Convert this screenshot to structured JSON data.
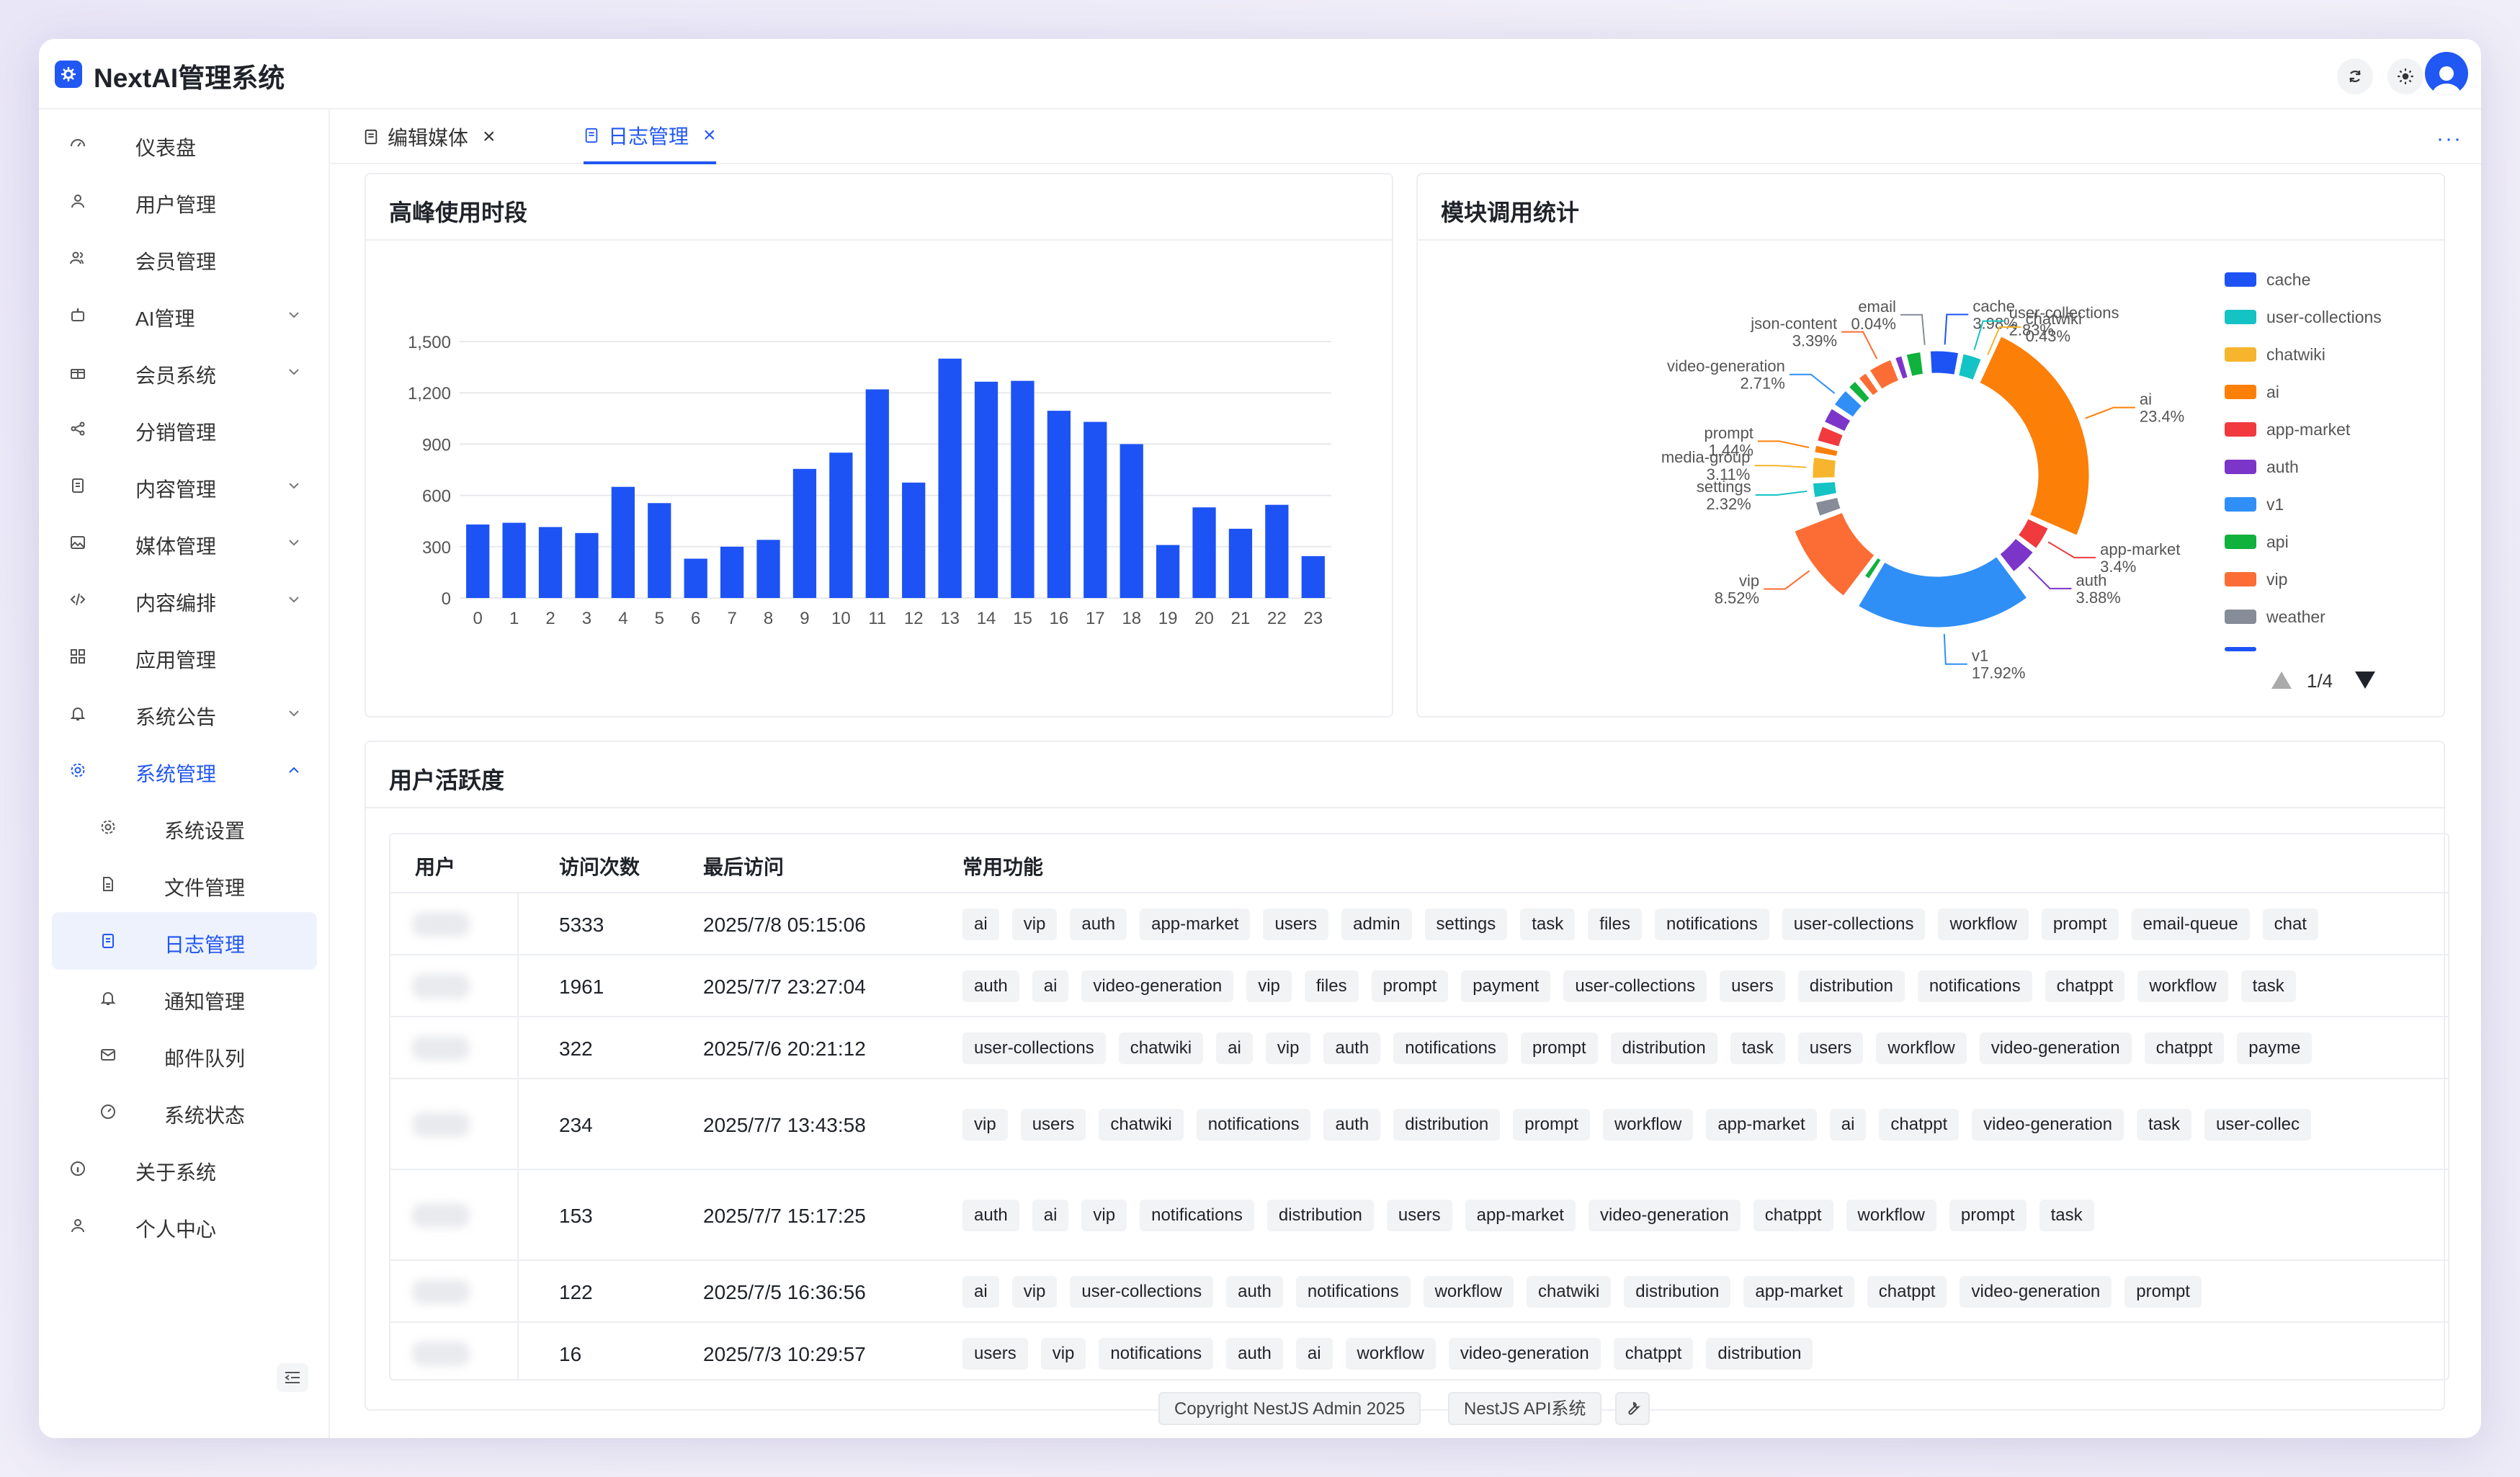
{
  "app": {
    "title": "NextAI管理系统"
  },
  "sidebar": {
    "items": [
      {
        "label": "仪表盘",
        "icon": "dashboard-icon",
        "expandable": false
      },
      {
        "label": "用户管理",
        "icon": "user-icon",
        "expandable": false
      },
      {
        "label": "会员管理",
        "icon": "members-icon",
        "expandable": false
      },
      {
        "label": "AI管理",
        "icon": "robot-icon",
        "expandable": true
      },
      {
        "label": "会员系统",
        "icon": "gift-icon",
        "expandable": true
      },
      {
        "label": "分销管理",
        "icon": "share-icon",
        "expandable": false
      },
      {
        "label": "内容管理",
        "icon": "document-icon",
        "expandable": true
      },
      {
        "label": "媒体管理",
        "icon": "image-icon",
        "expandable": true
      },
      {
        "label": "内容编排",
        "icon": "code-icon",
        "expandable": true
      },
      {
        "label": "应用管理",
        "icon": "apps-icon",
        "expandable": false
      },
      {
        "label": "系统公告",
        "icon": "bell-icon",
        "expandable": true
      },
      {
        "label": "系统管理",
        "icon": "gear-icon",
        "expandable": true,
        "expanded": true
      }
    ],
    "sub_items": [
      {
        "label": "系统设置",
        "icon": "gear-icon"
      },
      {
        "label": "文件管理",
        "icon": "file-icon"
      },
      {
        "label": "日志管理",
        "icon": "log-icon",
        "active": true
      },
      {
        "label": "通知管理",
        "icon": "bell-icon"
      },
      {
        "label": "邮件队列",
        "icon": "mail-icon"
      },
      {
        "label": "系统状态",
        "icon": "gauge-icon"
      }
    ],
    "bottom_items": [
      {
        "label": "关于系统",
        "icon": "info-icon"
      },
      {
        "label": "个人中心",
        "icon": "user-icon"
      }
    ]
  },
  "tabs": [
    {
      "label": "编辑媒体",
      "active": false
    },
    {
      "label": "日志管理",
      "active": true
    }
  ],
  "cards": {
    "peak": {
      "title": "高峰使用时段"
    },
    "modules": {
      "title": "模块调用统计",
      "pager": "1/4"
    },
    "activity": {
      "title": "用户活跃度"
    }
  },
  "chart_data": [
    {
      "type": "bar",
      "categories": [
        "0",
        "1",
        "2",
        "3",
        "4",
        "5",
        "6",
        "7",
        "8",
        "9",
        "10",
        "11",
        "12",
        "13",
        "14",
        "15",
        "16",
        "17",
        "18",
        "19",
        "20",
        "21",
        "22",
        "23"
      ],
      "values": [
        430,
        440,
        415,
        380,
        650,
        555,
        230,
        300,
        340,
        755,
        850,
        1220,
        675,
        1400,
        1265,
        1270,
        1095,
        1030,
        900,
        310,
        530,
        405,
        545,
        245
      ],
      "ylim": [
        0,
        1500
      ],
      "yticks": [
        0,
        300,
        600,
        900,
        1200,
        1500
      ],
      "ytick_labels": [
        "0",
        "300",
        "600",
        "900",
        "1,200",
        "1,500"
      ],
      "grid": true,
      "color": "#1d53f5"
    },
    {
      "type": "pie",
      "donut": true,
      "slices": [
        {
          "name": "cache",
          "label": "3.98%",
          "value": 3.98,
          "color": "#1d53f5"
        },
        {
          "name": "user-collections",
          "label": "2.83%",
          "value": 2.83,
          "color": "#14c3c4"
        },
        {
          "name": "chatwiki",
          "label": "0.43%",
          "value": 0.43,
          "color": "#f6b52c"
        },
        {
          "name": "ai",
          "label": "23.4%",
          "value": 23.4,
          "color": "#fc7f08"
        },
        {
          "name": "app-market",
          "label": "3.4%",
          "value": 3.4,
          "color": "#f03a3d"
        },
        {
          "name": "auth",
          "label": "3.88%",
          "value": 3.88,
          "color": "#7c35c9"
        },
        {
          "name": "v1",
          "label": "17.92%",
          "value": 17.92,
          "color": "#2f8ff6"
        },
        {
          "name": "api",
          "label": "",
          "value": 1.2,
          "color": "#10b13c"
        },
        {
          "name": "vip",
          "label": "8.52%",
          "value": 8.52,
          "color": "#fb6d34"
        },
        {
          "name": "weather",
          "label": "",
          "value": 2.3,
          "color": "#868c98"
        },
        {
          "name": "settings",
          "label": "2.32%",
          "value": 2.32,
          "color": "#14c3c4"
        },
        {
          "name": "media-group",
          "label": "3.11%",
          "value": 3.11,
          "color": "#f6b52c"
        },
        {
          "name": "prompt",
          "label": "1.44%",
          "value": 1.44,
          "color": "#fc7f08"
        },
        {
          "name": "",
          "label": "",
          "value": 2.4,
          "color": "#f03a3d"
        },
        {
          "name": "",
          "label": "",
          "value": 2.4,
          "color": "#7c35c9"
        },
        {
          "name": "video-generation",
          "label": "2.71%",
          "value": 2.71,
          "color": "#2f8ff6"
        },
        {
          "name": "",
          "label": "",
          "value": 1.6,
          "color": "#10b13c"
        },
        {
          "name": "",
          "label": "",
          "value": 1.6,
          "color": "#fb6d34"
        },
        {
          "name": "json-content",
          "label": "3.39%",
          "value": 3.39,
          "color": "#fb6d34"
        },
        {
          "name": "",
          "label": "",
          "value": 1.4,
          "color": "#7c35c9"
        },
        {
          "name": "",
          "label": "",
          "value": 2.3,
          "color": "#10b13c"
        },
        {
          "name": "email",
          "label": "0.04%",
          "value": 0.6,
          "color": "#868c98"
        }
      ],
      "legend": {
        "placement": "right",
        "items": [
          {
            "name": "cache",
            "color": "#1d53f5"
          },
          {
            "name": "user-collections",
            "color": "#14c3c4"
          },
          {
            "name": "chatwiki",
            "color": "#f6b52c"
          },
          {
            "name": "ai",
            "color": "#fc7f08"
          },
          {
            "name": "app-market",
            "color": "#f03a3d"
          },
          {
            "name": "auth",
            "color": "#7c35c9"
          },
          {
            "name": "v1",
            "color": "#2f8ff6"
          },
          {
            "name": "api",
            "color": "#10b13c"
          },
          {
            "name": "vip",
            "color": "#fb6d34"
          },
          {
            "name": "weather",
            "color": "#868c98"
          }
        ]
      }
    }
  ],
  "table": {
    "columns": [
      "用户",
      "访问次数",
      "最后访问",
      "常用功能"
    ],
    "rows": [
      {
        "count": "5333",
        "last": "2025/7/8 05:15:06",
        "tags": [
          "ai",
          "vip",
          "auth",
          "app-market",
          "users",
          "admin",
          "settings",
          "task",
          "files",
          "notifications",
          "user-collections",
          "workflow",
          "prompt",
          "email-queue",
          "chat"
        ]
      },
      {
        "count": "1961",
        "last": "2025/7/7 23:27:04",
        "tags": [
          "auth",
          "ai",
          "video-generation",
          "vip",
          "files",
          "prompt",
          "payment",
          "user-collections",
          "users",
          "distribution",
          "notifications",
          "chatppt",
          "workflow",
          "task"
        ]
      },
      {
        "count": "322",
        "last": "2025/7/6 20:21:12",
        "tags": [
          "user-collections",
          "chatwiki",
          "ai",
          "vip",
          "auth",
          "notifications",
          "prompt",
          "distribution",
          "task",
          "users",
          "workflow",
          "video-generation",
          "chatppt",
          "payme"
        ]
      },
      {
        "count": "234",
        "last": "2025/7/7 13:43:58",
        "tags": [
          "vip",
          "users",
          "chatwiki",
          "notifications",
          "auth",
          "distribution",
          "prompt",
          "workflow",
          "app-market",
          "ai",
          "chatppt",
          "video-generation",
          "task",
          "user-collec"
        ]
      },
      {
        "count": "153",
        "last": "2025/7/7 15:17:25",
        "tags": [
          "auth",
          "ai",
          "vip",
          "notifications",
          "distribution",
          "users",
          "app-market",
          "video-generation",
          "chatppt",
          "workflow",
          "prompt",
          "task"
        ]
      },
      {
        "count": "122",
        "last": "2025/7/5 16:36:56",
        "tags": [
          "ai",
          "vip",
          "user-collections",
          "auth",
          "notifications",
          "workflow",
          "chatwiki",
          "distribution",
          "app-market",
          "chatppt",
          "video-generation",
          "prompt"
        ]
      },
      {
        "count": "16",
        "last": "2025/7/3 10:29:57",
        "tags": [
          "users",
          "vip",
          "notifications",
          "auth",
          "ai",
          "workflow",
          "video-generation",
          "chatppt",
          "distribution"
        ]
      }
    ]
  },
  "footer": {
    "copyright": "Copyright NestJS Admin 2025",
    "api_label": "NestJS API系统"
  },
  "colors": {
    "accent": "#2157f2"
  }
}
